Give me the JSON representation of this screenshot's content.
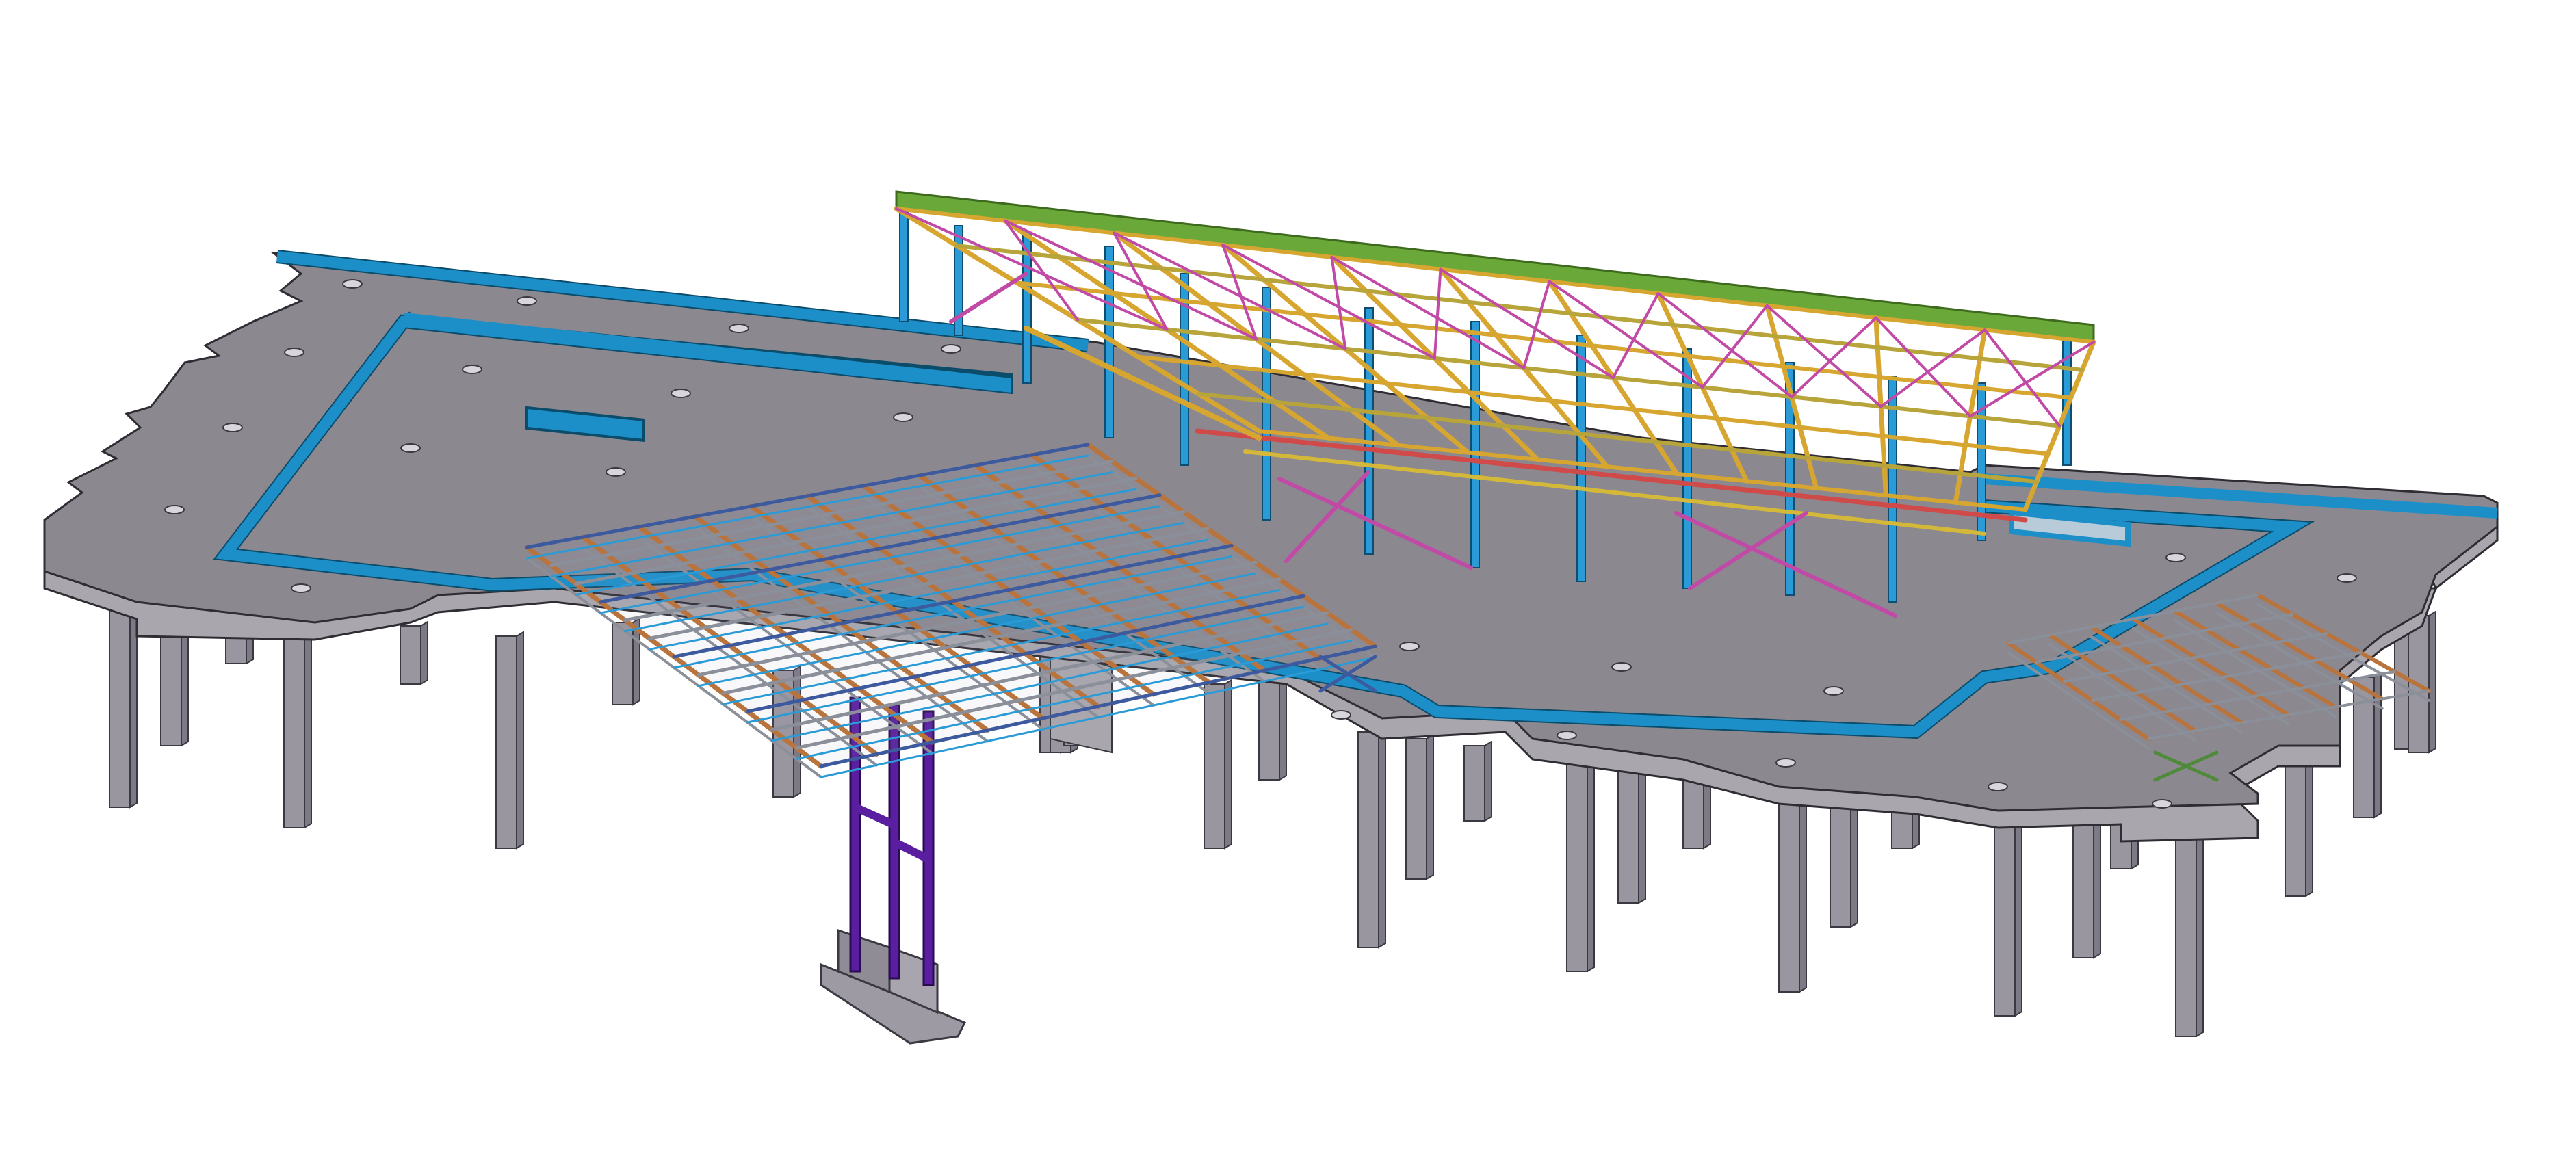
{
  "scene": {
    "type": "3d-structural-model-view",
    "colors": {
      "background": "#ffffff",
      "slab": "#8b8890",
      "slab_edge": "#a9a6ae",
      "column": "#9a96a0",
      "wall_blue": "#1c8fc9",
      "roof_green": "#6aa83a",
      "truss_yellow": "#d6a630",
      "bracing_magenta": "#c04aa6",
      "truss_orange": "#b8743c",
      "truss_gray": "#8a8f99",
      "steel_purple": "#5a1fa0",
      "beam_red": "#d04a4a"
    }
  }
}
